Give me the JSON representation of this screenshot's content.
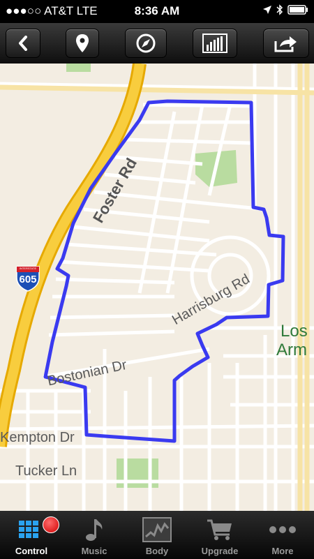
{
  "status_bar": {
    "carrier": "●●●○○ AT&T  LTE",
    "time": "8:36 AM"
  },
  "toolbar": {
    "buttons": [
      {
        "name": "back",
        "icon": "chevron-left-icon"
      },
      {
        "name": "location",
        "icon": "map-pin-icon"
      },
      {
        "name": "compass",
        "icon": "compass-icon"
      },
      {
        "name": "stats",
        "icon": "bar-chart-icon"
      },
      {
        "name": "share",
        "icon": "share-icon"
      }
    ]
  },
  "map": {
    "highway_shield": "605",
    "highway_shield_top": "INTERSTATE",
    "labels": {
      "foster": "Foster Rd",
      "harrisburg": "Harrisburg Rd",
      "bostonian": "Bostonian Dr",
      "kempton": "Kempton Dr",
      "tucker": "Tucker Ln",
      "los_alamitos_1": "Los",
      "los_alamitos_2": "Arm"
    },
    "route_color": "#3a3af0"
  },
  "tabbar": {
    "tabs": [
      {
        "label": "Control",
        "icon": "grid-icon",
        "active": true
      },
      {
        "label": "Music",
        "icon": "music-note-icon",
        "active": false
      },
      {
        "label": "Body",
        "icon": "heart-rate-graph-icon",
        "active": false
      },
      {
        "label": "Upgrade",
        "icon": "shopping-cart-icon",
        "active": false
      },
      {
        "label": "More",
        "icon": "more-dots-icon",
        "active": false
      }
    ]
  }
}
